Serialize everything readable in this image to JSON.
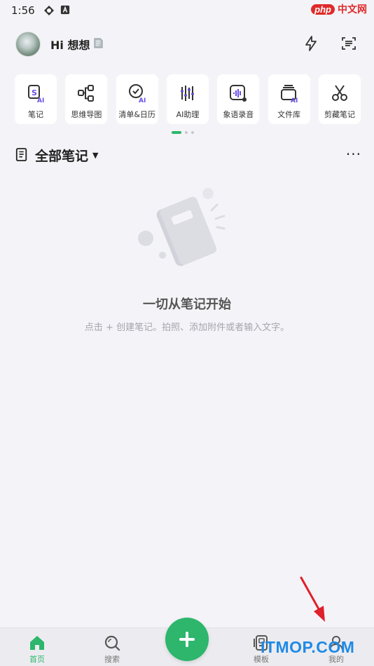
{
  "status_bar": {
    "time": "1:56",
    "icons": [
      "signal-sync-icon",
      "app-notification-icon"
    ]
  },
  "watermark_top": {
    "php": "php",
    "cn": "中文网"
  },
  "header": {
    "greeting": "Hi 想想",
    "icons": [
      "flash-icon",
      "scan-icon"
    ]
  },
  "tools": [
    {
      "label": "笔记",
      "icon": "note-ai-icon"
    },
    {
      "label": "思维导图",
      "icon": "mindmap-icon"
    },
    {
      "label": "清单&日历",
      "icon": "checklist-ai-icon"
    },
    {
      "label": "AI助理",
      "icon": "ai-assistant-icon"
    },
    {
      "label": "象语录音",
      "icon": "voice-record-icon"
    },
    {
      "label": "文件库",
      "icon": "file-library-icon"
    },
    {
      "label": "剪藏笔记",
      "icon": "clip-note-icon"
    }
  ],
  "pager": {
    "pages": 3,
    "active": 0
  },
  "section": {
    "title": "全部笔记",
    "more": "···"
  },
  "empty_state": {
    "title": "一切从笔记开始",
    "subtitle": "点击 + 创建笔记。拍照、添加附件或者输入文字。"
  },
  "tabbar": {
    "tabs": [
      {
        "label": "首页",
        "icon": "home-icon",
        "active": true
      },
      {
        "label": "搜索",
        "icon": "search-icon",
        "active": false
      },
      {
        "label": "模板",
        "icon": "template-icon",
        "active": false
      },
      {
        "label": "我的",
        "icon": "profile-icon",
        "active": false
      }
    ],
    "fab_icon": "plus-icon"
  },
  "watermark_bottom": "ITMOP.COM",
  "colors": {
    "accent": "#2db66c",
    "background": "#f4f4f8",
    "ai_purple": "#6b4ee6"
  }
}
